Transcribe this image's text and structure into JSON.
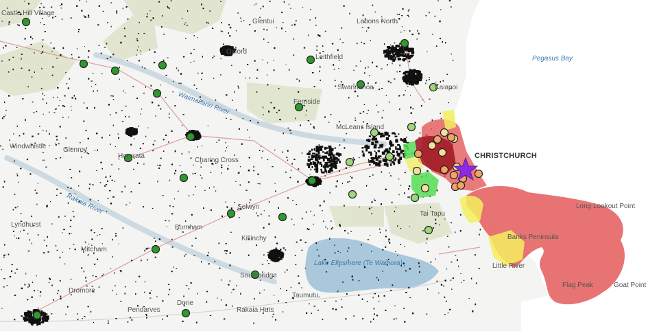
{
  "labels": {
    "castle_hill": "Castle Hill Village",
    "glentui": "Glentui",
    "leithfield": "Leithfield",
    "oxford": "Oxford",
    "swannanoa": "Swannanoa",
    "kaiapoi": "Kaiapoi",
    "fernside": "Fernside",
    "waimakariri_river": "Waimakariri River",
    "pegasus_bay": "Pegasus Bay",
    "mcleans_island": "McLeans Island",
    "christchurch": "CHRISTCHURCH",
    "windwhistle": "Windwhistle",
    "glenroy": "Glenroy",
    "hororata": "Hororata",
    "charing_cross": "Charing Cross",
    "rakaia_river": "Rakaia River",
    "selwyn": "Selwyn",
    "lyndhurst": "Lyndhurst",
    "burnham": "Burnham",
    "killinchy": "Killinchy",
    "tai_tapu": "Tai Tapu",
    "long_lookout_point": "Long Lookout Point",
    "banks_peninsula": "Banks Peninsula",
    "mitcham": "Mitcham",
    "lake_ellesmere": "Lake Ellesmere (Te Waihora)",
    "little_river": "Little River",
    "southbridge": "Southbridge",
    "flag_peak": "Flag Peak",
    "goat_point": "Goat Point",
    "dorie": "Dorie",
    "rakaia_huts": "Rakaia Huts",
    "pendarves": "Pendarves",
    "taumutu": "Taumutu",
    "dromore": "Dromore",
    "lebons_north": "Lebons North"
  },
  "colors": {
    "land": "#f4f4f2",
    "sea": "#ffffff",
    "lake": "#a9c8dc",
    "hills": "#d9dfc5",
    "urban": "#111111",
    "zone_red": "#e45a5a",
    "zone_darkred": "#b0202a",
    "zone_yellow": "#f3ef5e",
    "zone_green": "#55dd55",
    "marker_dark_green": "#2e9a2e",
    "marker_light_green": "#9ed67a",
    "marker_cream": "#f5dd9a",
    "marker_orange": "#f2a26a",
    "star": "#8a2be2"
  },
  "icons": {
    "epicentre": "star-icon"
  }
}
